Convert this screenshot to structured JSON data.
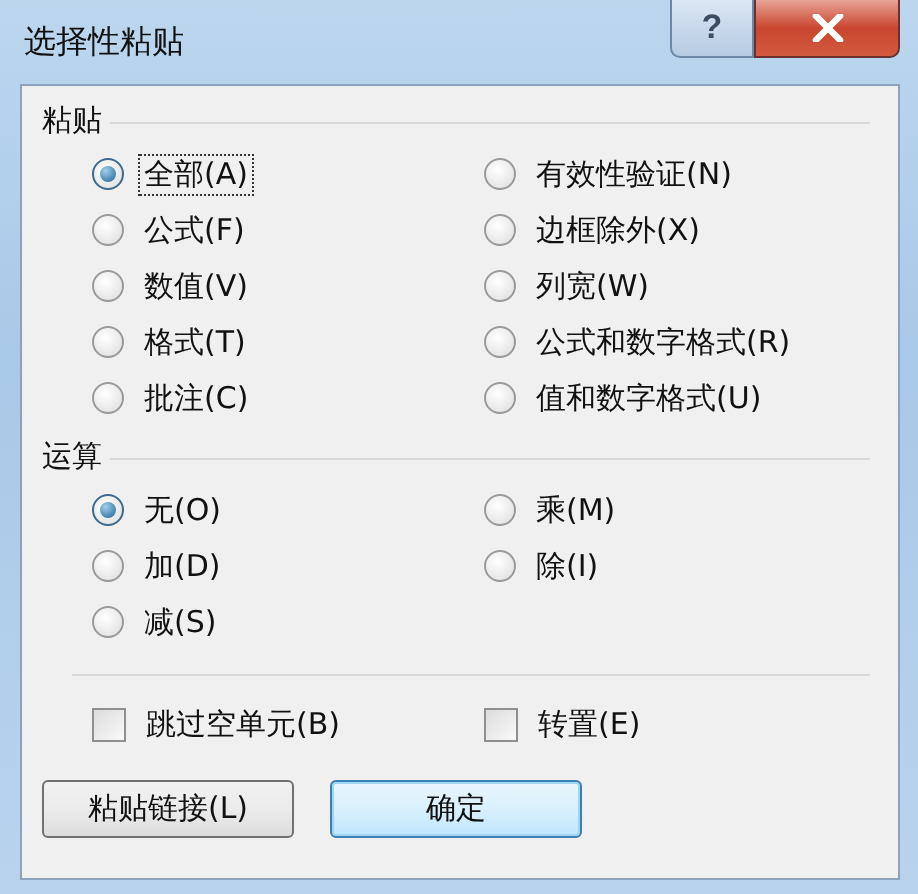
{
  "window": {
    "title": "选择性粘贴",
    "help_label": "?"
  },
  "paste": {
    "heading": "粘贴",
    "options": [
      {
        "label": "全部(A)",
        "selected": true,
        "focused": true
      },
      {
        "label": "公式(F)",
        "selected": false,
        "focused": false
      },
      {
        "label": "数值(V)",
        "selected": false,
        "focused": false
      },
      {
        "label": "格式(T)",
        "selected": false,
        "focused": false
      },
      {
        "label": "批注(C)",
        "selected": false,
        "focused": false
      },
      {
        "label": "有效性验证(N)",
        "selected": false,
        "focused": false
      },
      {
        "label": "边框除外(X)",
        "selected": false,
        "focused": false
      },
      {
        "label": "列宽(W)",
        "selected": false,
        "focused": false
      },
      {
        "label": "公式和数字格式(R)",
        "selected": false,
        "focused": false
      },
      {
        "label": "值和数字格式(U)",
        "selected": false,
        "focused": false
      }
    ]
  },
  "operation": {
    "heading": "运算",
    "options": [
      {
        "label": "无(O)",
        "selected": true
      },
      {
        "label": "加(D)",
        "selected": false
      },
      {
        "label": "减(S)",
        "selected": false
      },
      {
        "label": "乘(M)",
        "selected": false
      },
      {
        "label": "除(I)",
        "selected": false
      }
    ]
  },
  "checkboxes": [
    {
      "label": "跳过空单元(B)",
      "checked": false
    },
    {
      "label": "转置(E)",
      "checked": false
    }
  ],
  "buttons": [
    {
      "label": "粘贴链接(L)",
      "default": false
    },
    {
      "label": "确定",
      "default": true
    }
  ]
}
